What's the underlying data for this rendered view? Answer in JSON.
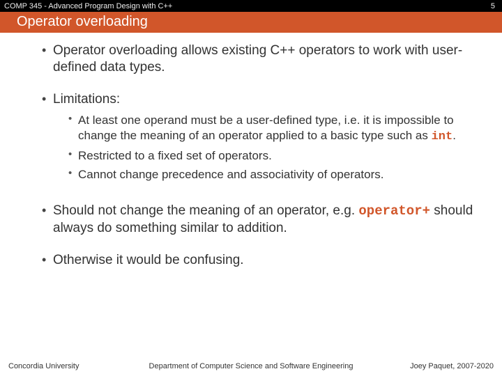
{
  "header": {
    "course": "COMP 345 - Advanced Program Design with C++",
    "page_number": "5",
    "title": "Operator overloading"
  },
  "body": {
    "p1": "Operator overloading allows existing C++ operators to work with user-defined data types.",
    "limitations_label": "Limitations:",
    "limits": {
      "l1a": "At least one operand must be a user-defined type, i.e. it is impossible to change the meaning of an operator applied to a basic type such as ",
      "l1_code": "int",
      "l1b": ".",
      "l2": "Restricted to a fixed set of operators.",
      "l3": "Cannot change precedence and associativity of operators."
    },
    "p3a": "Should not change the meaning of an operator, e.g. ",
    "p3_code": "operator+",
    "p3b": " should always do something similar to addition.",
    "p4": "Otherwise it would be confusing."
  },
  "footer": {
    "left": "Concordia University",
    "center": "Department of Computer Science and Software Engineering",
    "right": "Joey Paquet, 2007-2020"
  }
}
